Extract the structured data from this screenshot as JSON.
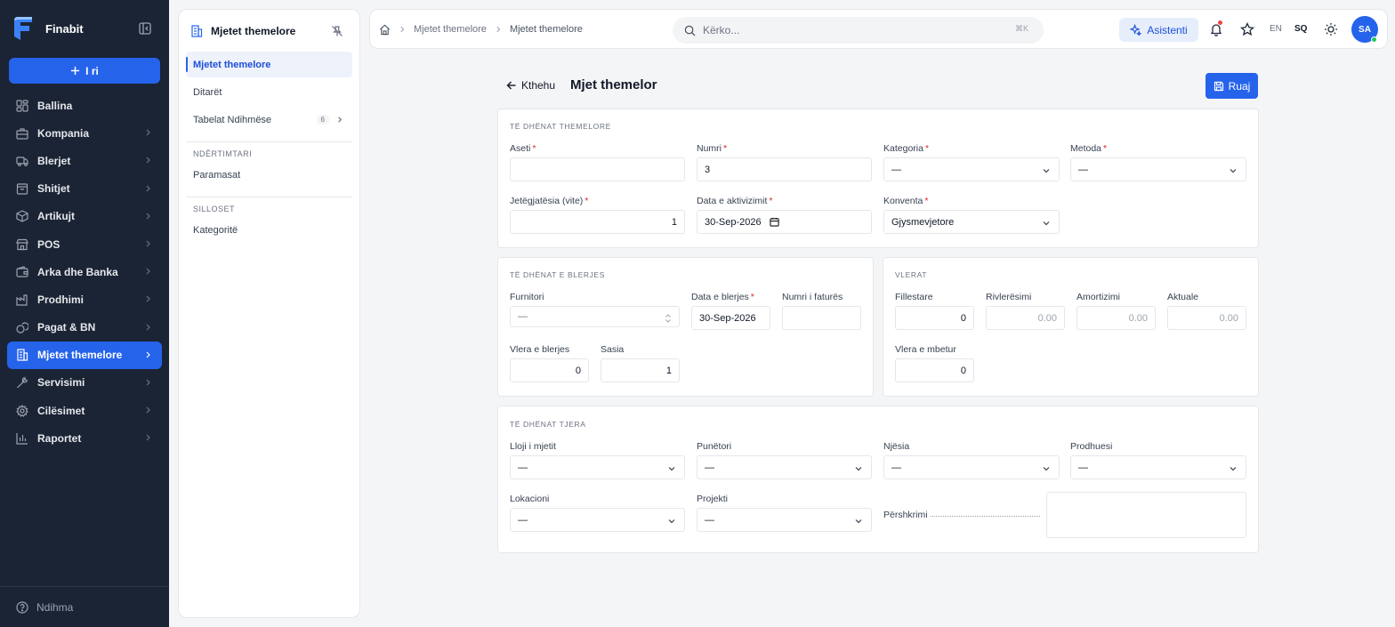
{
  "sidebar": {
    "brand": "Finabit",
    "new_button": "I ri",
    "items": [
      {
        "label": "Ballina",
        "icon": "dashboard-icon",
        "chevron": false
      },
      {
        "label": "Kompania",
        "icon": "building-icon",
        "chevron": true
      },
      {
        "label": "Blerjet",
        "icon": "truck-icon",
        "chevron": true
      },
      {
        "label": "Shitjet",
        "icon": "shopping-bag-icon",
        "chevron": true
      },
      {
        "label": "Artikujt",
        "icon": "box-icon",
        "chevron": true
      },
      {
        "label": "POS",
        "icon": "store-icon",
        "chevron": true
      },
      {
        "label": "Arka dhe Banka",
        "icon": "wallet-icon",
        "chevron": true
      },
      {
        "label": "Prodhimi",
        "icon": "factory-icon",
        "chevron": true
      },
      {
        "label": "Pagat & BN",
        "icon": "coins-icon",
        "chevron": true
      },
      {
        "label": "Mjetet themelore",
        "icon": "asset-building-icon",
        "chevron": true,
        "active": true
      },
      {
        "label": "Servisimi",
        "icon": "wrench-icon",
        "chevron": true
      },
      {
        "label": "Cilësimet",
        "icon": "gear-icon",
        "chevron": true
      },
      {
        "label": "Raportet",
        "icon": "bar-chart-icon",
        "chevron": true
      }
    ],
    "help": "Ndihma"
  },
  "subpanel": {
    "title": "Mjetet themelore",
    "items": [
      {
        "label": "Mjetet themelore",
        "active": true
      },
      {
        "label": "Ditarët"
      },
      {
        "label": "Tabelat Ndihmëse",
        "badge": "6"
      }
    ],
    "sections": [
      {
        "title": "NDËRTIMTARI",
        "items": [
          "Paramasat"
        ]
      },
      {
        "title": "SILLOSET",
        "items": [
          "Kategoritë"
        ]
      }
    ]
  },
  "topbar": {
    "breadcrumb": [
      "Mjetet themelore",
      "Mjetet themelore"
    ],
    "search_placeholder": "Kërko...",
    "search_shortcut": "⌘K",
    "assistant": "Asistenti",
    "lang_en": "EN",
    "lang_sq": "SQ",
    "avatar": "SA"
  },
  "page": {
    "back": "Kthehu",
    "title": "Mjet themelor",
    "save": "Ruaj"
  },
  "basic": {
    "title": "TË DHËNAT THEMELORE",
    "aseti_label": "Aseti",
    "aseti_value": "",
    "numri_label": "Numri",
    "numri_value": "3",
    "kategoria_label": "Kategoria",
    "kategoria_value": "—",
    "metoda_label": "Metoda",
    "metoda_value": "—",
    "jetegjatesia_label": "Jetëgjatësia (vite)",
    "jetegjatesia_value": "1",
    "data_aktivizimit_label": "Data e aktivizimit",
    "data_aktivizimit_value": "30-Sep-2026",
    "konventa_label": "Konventa",
    "konventa_value": "Gjysmevjetore"
  },
  "purchase": {
    "title": "TË DHËNAT E BLERJES",
    "furnitori_label": "Furnitori",
    "furnitori_value": "—",
    "data_blerjes_label": "Data e blerjes",
    "data_blerjes_value": "30-Sep-2026",
    "numri_fatures_label": "Numri i faturës",
    "numri_fatures_value": "",
    "vlera_blerjes_label": "Vlera e blerjes",
    "vlera_blerjes_value": "0",
    "sasia_label": "Sasia",
    "sasia_value": "1"
  },
  "values": {
    "title": "VLERAT",
    "fillestare_label": "Fillestare",
    "fillestare_value": "0",
    "rivleresimi_label": "Rivlerësimi",
    "rivleresimi_placeholder": "0.00",
    "amortizimi_label": "Amortizimi",
    "amortizimi_placeholder": "0.00",
    "aktuale_label": "Aktuale",
    "aktuale_placeholder": "0.00",
    "vlera_mbetur_label": "Vlera e mbetur",
    "vlera_mbetur_value": "0"
  },
  "other": {
    "title": "TË DHËNAT TJERA",
    "lloji_label": "Lloji i mjetit",
    "lloji_value": "—",
    "punetori_label": "Punëtori",
    "punetori_value": "—",
    "njesia_label": "Njësia",
    "njesia_value": "—",
    "prodhuesi_label": "Prodhuesi",
    "prodhuesi_value": "—",
    "lokacioni_label": "Lokacioni",
    "lokacioni_value": "—",
    "projekti_label": "Projekti",
    "projekti_value": "—",
    "pershkrimi_label": "Përshkrimi",
    "pershkrimi_value": ""
  },
  "colors": {
    "sidebar_bg": "#1b2435",
    "accent": "#2563eb",
    "required": "#dc2626",
    "online": "#22c55e"
  }
}
